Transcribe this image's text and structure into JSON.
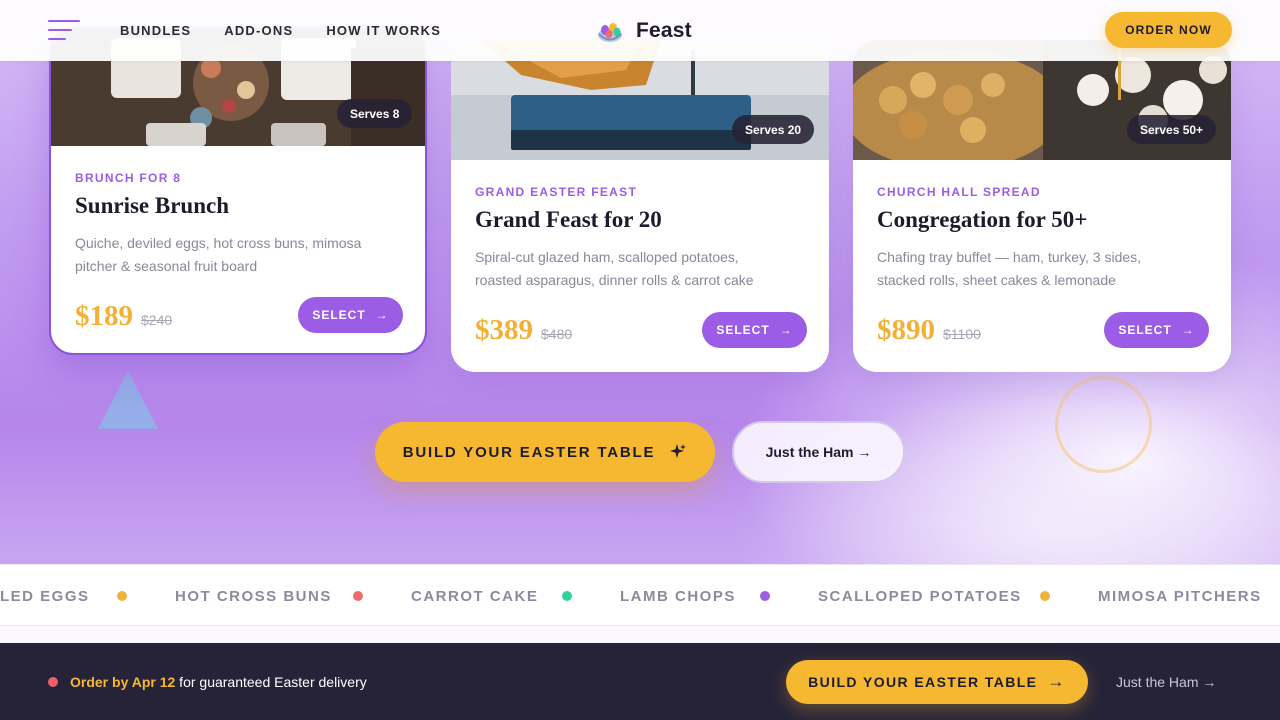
{
  "header": {
    "nav": [
      "BUNDLES",
      "ADD-ONS",
      "HOW IT WORKS"
    ],
    "brand": "Feast",
    "order_label": "ORDER NOW"
  },
  "cards": [
    {
      "eyebrow": "BRUNCH FOR 8",
      "title": "Sunrise Brunch",
      "desc": "Quiche, deviled eggs, hot cross buns, mimosa pitcher & seasonal fruit board",
      "price": "$189",
      "old_price": "$240",
      "badge": "Serves 8",
      "select_label": "SELECT"
    },
    {
      "eyebrow": "GRAND EASTER FEAST",
      "title": "Grand Feast for 20",
      "desc": "Spiral-cut glazed ham, scalloped potatoes, roasted asparagus, dinner rolls & carrot cake",
      "price": "$389",
      "old_price": "$480",
      "badge": "Serves 20",
      "select_label": "SELECT"
    },
    {
      "eyebrow": "CHURCH HALL SPREAD",
      "title": "Congregation for 50+",
      "desc": "Chafing tray buffet — ham, turkey, 3 sides, stacked rolls, sheet cakes & lemonade",
      "price": "$890",
      "old_price": "$1100",
      "badge": "Serves 50+",
      "select_label": "SELECT"
    }
  ],
  "cta": {
    "primary": "BUILD YOUR EASTER TABLE",
    "secondary": "Just the Ham →"
  },
  "ticker": {
    "items": [
      "LED EGGS",
      "HOT CROSS BUNS",
      "CARROT CAKE",
      "LAMB CHOPS",
      "SCALLOPED POTATOES",
      "MIMOSA PITCHERS"
    ],
    "dot_colors": [
      "#f0b23a",
      "#ef6a6e",
      "#2fd39f",
      "#9b5de5",
      "#f0b23a"
    ]
  },
  "bottom_bar": {
    "deadline": "Order by Apr 12",
    "rest": " for guaranteed Easter delivery",
    "cta": "BUILD YOUR EASTER TABLE",
    "link": "Just the Ham →"
  },
  "colors": {
    "accent_purple": "#9b5de5",
    "accent_gold": "#f6b731",
    "dark": "#262338"
  }
}
